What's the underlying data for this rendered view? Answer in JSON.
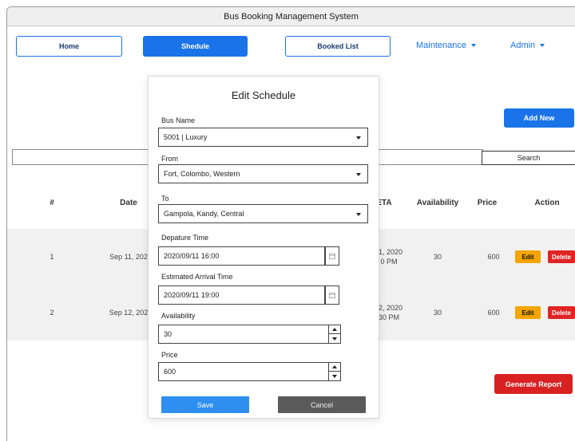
{
  "app": {
    "title": "Bus Booking Management System"
  },
  "nav": {
    "home": "Home",
    "schedule": "Shedule",
    "booked_list": "Booked List",
    "maintenance": "Maintenance",
    "admin": "Admin"
  },
  "toolbar": {
    "add_new": "Add New",
    "search": "Search",
    "search_value": ""
  },
  "table": {
    "headers": [
      "#",
      "Date",
      "ETA",
      "Availability",
      "Price",
      "Action"
    ],
    "rows": [
      {
        "num": "1",
        "date": "Sep 11, 202",
        "eta_line1": "1, 2020",
        "eta_line2": "0 PM",
        "availability": "30",
        "price": "600",
        "edit": "Edit",
        "delete": "Delete"
      },
      {
        "num": "2",
        "date": "Sep 12, 202",
        "eta_line1": "2, 2020",
        "eta_line2": "30 PM",
        "availability": "30",
        "price": "600",
        "edit": "Edit",
        "delete": "Delete"
      }
    ]
  },
  "report_button": "Generate Report",
  "modal": {
    "title": "Edit Schedule",
    "bus_name_label": "Bus Name",
    "bus_name_value": "5001 | Luxury",
    "from_label": "From",
    "from_value": "Fort, Colombo, Western",
    "to_label": "To",
    "to_value": "Gampola, Kandy, Central",
    "departure_label": "Depature Time",
    "departure_value": "2020/09/11 16:00",
    "arrival_label": "Estimated Arrival Time",
    "arrival_value": "2020/09/11 19:00",
    "availability_label": "Availability",
    "availability_value": "30",
    "price_label": "Price",
    "price_value": "600",
    "save": "Save",
    "cancel": "Cancel"
  },
  "icons": {
    "calendar": "calendar-icon",
    "dropdown": "chevron-down-icon",
    "spinner": "stepper-icon"
  },
  "colors": {
    "primary": "#1a73e8",
    "warning": "#f4a500",
    "danger": "#e02424",
    "report": "#d92121",
    "cancel": "#5b5b5b"
  }
}
